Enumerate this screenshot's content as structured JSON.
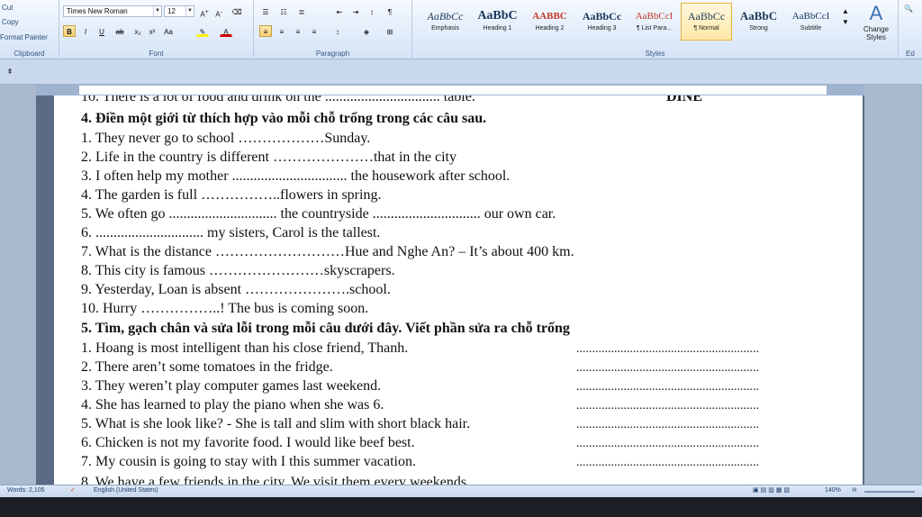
{
  "ribbon": {
    "clipboard": {
      "cut": "Cut",
      "copy": "Copy",
      "format_painter": "Format Painter",
      "label": "Clipboard"
    },
    "font": {
      "family": "Times New Roman",
      "size": "12",
      "label": "Font"
    },
    "paragraph": {
      "label": "Paragraph"
    },
    "styles": {
      "label": "Styles",
      "items": [
        {
          "sample": "AaBbCc",
          "name": "Emphasis"
        },
        {
          "sample": "AaBbC",
          "name": "Heading 1"
        },
        {
          "sample": "AABBC",
          "name": "Heading 2"
        },
        {
          "sample": "AaBbCc",
          "name": "Heading 3"
        },
        {
          "sample": "AaBbCcI",
          "name": "¶ List Para..."
        },
        {
          "sample": "AaBbCc",
          "name": "¶ Normal"
        },
        {
          "sample": "AaBbC",
          "name": "Strong"
        },
        {
          "sample": "AaBbCcI",
          "name": "Subtitle"
        }
      ],
      "change_styles": "Change Styles"
    },
    "editing_label": "Ed"
  },
  "document": {
    "top_partial_line": "10. There is a lot of food and drink on the ................................ table.",
    "top_partial_right": "DINE",
    "section4_heading": "4. Điền một giới từ thích hợp vào mỗi chỗ trống trong các câu sau.",
    "section4": [
      "1. They never go to school ………………Sunday.",
      "2. Life in the country is different …………………that in the city",
      "3. I often help my mother ................................ the housework after school.",
      "4. The garden is full ……………..flowers in spring.",
      "5. We often go .............................. the countryside .............................. our own car.",
      "6. .............................. my sisters, Carol is the tallest.",
      "7. What is the distance ………………………Hue and Nghe An? – It’s about 400 km.",
      "8. This city is famous ……………………skyscrapers.",
      "9. Yesterday, Loan is absent ………………….school.",
      "10. Hurry ……………..! The bus is coming soon."
    ],
    "section5_heading": "5. Tìm, gạch chân và sửa lỗi trong mỗi câu dưới đây. Viết phần sửa ra chỗ trống",
    "section5": [
      "1. Hoang is most intelligent than his close friend, Thanh.",
      "2. There aren’t some tomatoes in the fridge.",
      "3. They weren’t play computer games last weekend.",
      "4. She has learned to play the piano when she was 6.",
      "5. What is she look like? - She is tall and slim with short black hair.",
      "6. Chicken is not my favorite food. I would like beef best.",
      "7. My cousin is going to stay with I this summer vacation."
    ],
    "answer_blank": "..........................................................",
    "bottom_partial_line": "8. We have a few friends in the city. We visit them every weekends."
  },
  "status": {
    "words": "Words: 2,105",
    "language": "English (United States)",
    "zoom": "140%"
  }
}
